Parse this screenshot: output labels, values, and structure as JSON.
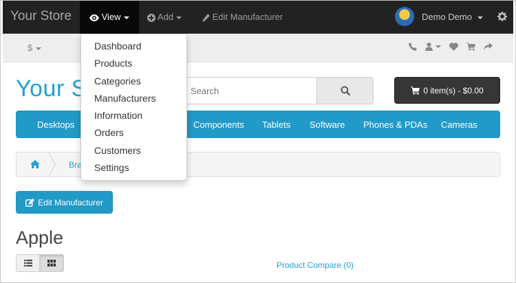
{
  "adminbar": {
    "brand": "Your Store",
    "view_label": "View",
    "add_label": "Add",
    "edit_label": "Edit Manufacturer",
    "username": "Demo Demo"
  },
  "view_menu": {
    "items": [
      "Dashboard",
      "Products",
      "Categories",
      "Manufacturers",
      "Information",
      "Orders",
      "Customers",
      "Settings"
    ]
  },
  "topbar": {
    "currency": "$"
  },
  "header": {
    "logo": "Your Store",
    "search_placeholder": "Search",
    "cart": "0 item(s) - $0.00"
  },
  "menu": {
    "items": [
      "Desktops",
      "Components",
      "Tablets",
      "Software",
      "Phones & PDAs",
      "Cameras"
    ]
  },
  "breadcrumb": {
    "link": "Brands"
  },
  "content": {
    "edit_button": "Edit Manufacturer",
    "title": "Apple",
    "compare": "Product Compare (0)"
  },
  "colors": {
    "accent": "#229ac8",
    "link": "#23a1d1",
    "adminbar": "#222222"
  }
}
